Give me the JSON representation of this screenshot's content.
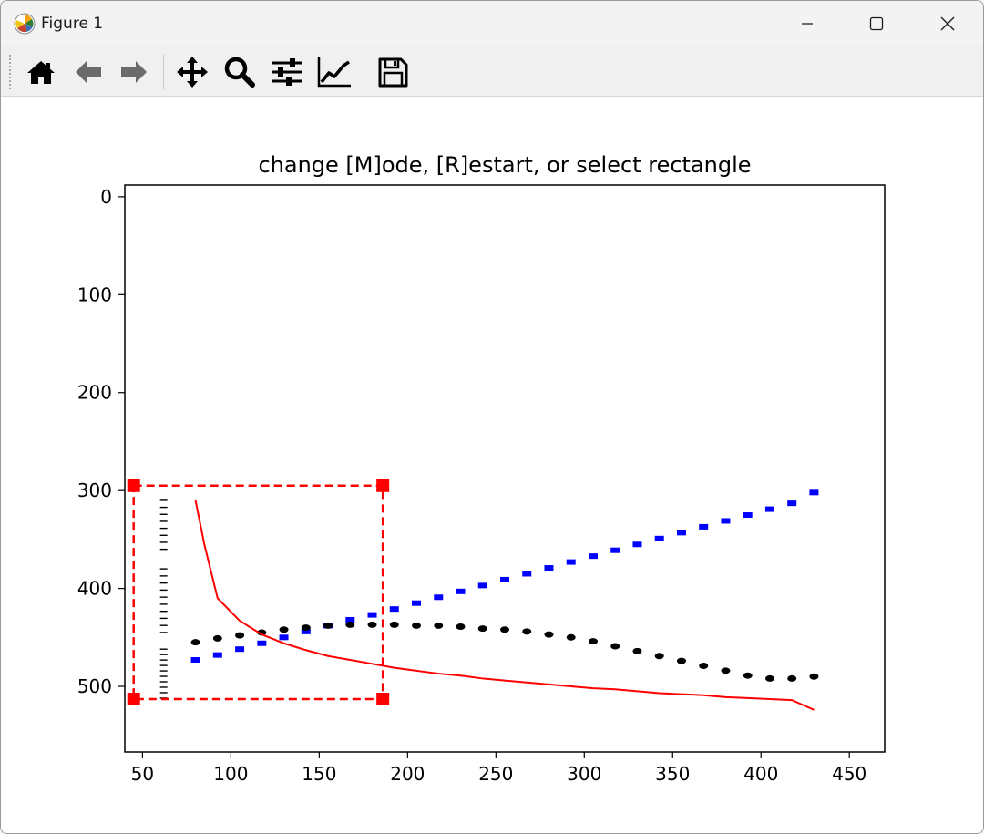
{
  "window": {
    "title": "Figure 1"
  },
  "toolbar": {
    "buttons": [
      {
        "name": "home-icon"
      },
      {
        "name": "back-arrow-icon"
      },
      {
        "name": "forward-arrow-icon"
      },
      {
        "name": "pan-icon"
      },
      {
        "name": "zoom-icon"
      },
      {
        "name": "configure-subplots-icon"
      },
      {
        "name": "edit-axis-icon"
      },
      {
        "name": "save-icon"
      }
    ]
  },
  "colors": {
    "red": "#ff0000",
    "blue": "#0000ff",
    "black": "#000000"
  },
  "chart_data": {
    "type": "line",
    "title": "change [M]ode, [R]estart, or select rectangle",
    "xlabel": "",
    "ylabel": "",
    "xlim": [
      40,
      470
    ],
    "ylim": [
      567,
      -12
    ],
    "y_inverted": true,
    "xticks": [
      50,
      100,
      150,
      200,
      250,
      300,
      350,
      400,
      450
    ],
    "yticks": [
      0,
      100,
      200,
      300,
      400,
      500
    ],
    "grid": false,
    "series": [
      {
        "style": "dotted-square",
        "color": "#0000ff",
        "x": [
          80,
          92.5,
          105,
          117.5,
          130,
          142.5,
          155,
          167.5,
          180,
          192.5,
          205,
          217.5,
          230,
          242.5,
          255,
          267.5,
          280,
          292.5,
          305,
          317.5,
          330,
          342.5,
          355,
          367.5,
          380,
          392.5,
          405,
          417.5,
          430
        ],
        "y": [
          473,
          468,
          462,
          456,
          450,
          444,
          438,
          432,
          427,
          421,
          415,
          409,
          403,
          397,
          391,
          385,
          379,
          373,
          367,
          361,
          355,
          349,
          343,
          337,
          331,
          325,
          319,
          313,
          302
        ]
      },
      {
        "style": "dotted-round",
        "color": "#000000",
        "x": [
          80,
          92.5,
          105,
          117.5,
          130,
          142.5,
          155,
          167.5,
          180,
          192.5,
          205,
          217.5,
          230,
          242.5,
          255,
          267.5,
          280,
          292.5,
          305,
          317.5,
          330,
          342.5,
          355,
          367.5,
          380,
          392.5,
          405,
          417.5,
          430
        ],
        "y": [
          455,
          451,
          448,
          445,
          442,
          440,
          438,
          437,
          437,
          437,
          438,
          438,
          439,
          441,
          442,
          444,
          447,
          450,
          454,
          459,
          464,
          469,
          474,
          479,
          484,
          489,
          492,
          492,
          490
        ]
      },
      {
        "style": "solid",
        "color": "#ff0000",
        "x": [
          80,
          85,
          92.5,
          105,
          117.5,
          130,
          142.5,
          155,
          167.5,
          180,
          192.5,
          205,
          217.5,
          230,
          242.5,
          255,
          267.5,
          280,
          292.5,
          305,
          317.5,
          330,
          342.5,
          355,
          367.5,
          380,
          392.5,
          405,
          417.5,
          430
        ],
        "y": [
          310,
          355,
          410,
          433,
          447,
          456,
          463,
          469,
          473,
          477,
          481,
          484,
          487,
          489,
          492,
          494,
          496,
          498,
          500,
          502,
          503,
          505,
          507,
          508,
          509,
          511,
          512,
          513,
          514,
          524
        ]
      }
    ],
    "selection_rectangle": {
      "color": "#ff0000",
      "x": [
        45,
        186
      ],
      "y": [
        295,
        513
      ]
    },
    "tick_column": {
      "x": 62,
      "y_start": 310,
      "y_end": 512
    }
  }
}
